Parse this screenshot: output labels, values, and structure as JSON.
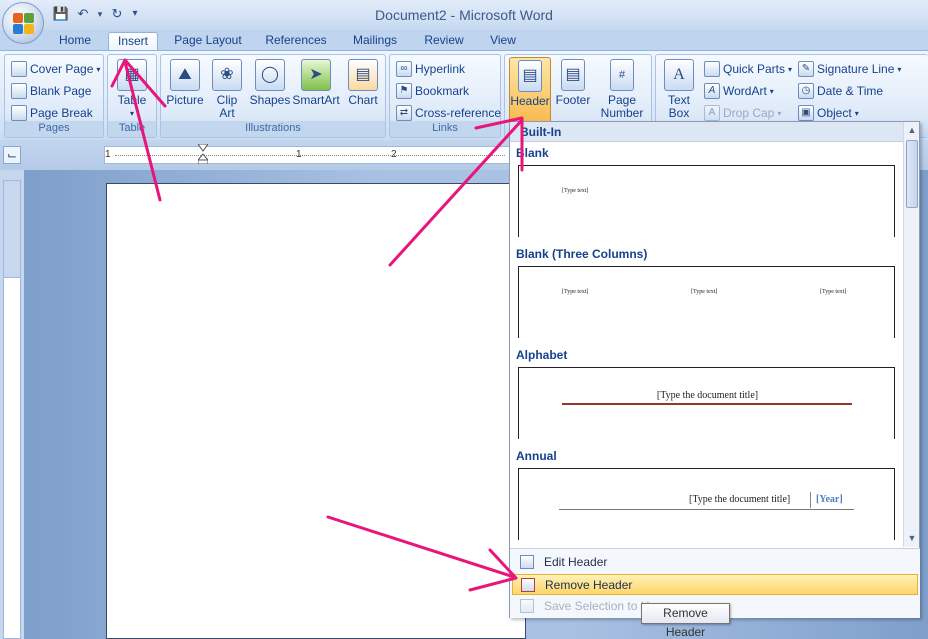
{
  "window": {
    "title": "Document2 - Microsoft Word"
  },
  "qat": {
    "save_icon": "save-icon",
    "undo_icon": "undo-icon",
    "redo_icon": "redo-icon",
    "customize_icon": "customize-qat-icon"
  },
  "tabs": [
    {
      "label": "Home"
    },
    {
      "label": "Insert",
      "active": true
    },
    {
      "label": "Page Layout"
    },
    {
      "label": "References"
    },
    {
      "label": "Mailings"
    },
    {
      "label": "Review"
    },
    {
      "label": "View"
    }
  ],
  "ribbon": {
    "pages": {
      "label": "Pages",
      "cover_page": "Cover Page",
      "blank_page": "Blank Page",
      "page_break": "Page Break"
    },
    "tables": {
      "label": "Table",
      "table": "Table"
    },
    "illustrations": {
      "label": "Illustrations",
      "picture": "Picture",
      "clip_art_1": "Clip",
      "clip_art_2": "Art",
      "shapes": "Shapes",
      "smartart": "SmartArt",
      "chart": "Chart"
    },
    "links": {
      "label": "Links",
      "hyperlink": "Hyperlink",
      "bookmark": "Bookmark",
      "cross_reference": "Cross-reference"
    },
    "header_footer": {
      "header": "Header",
      "footer": "Footer",
      "page_number_1": "Page",
      "page_number_2": "Number"
    },
    "text": {
      "text_box_1": "Text",
      "text_box_2": "Box",
      "quick_parts": "Quick Parts",
      "wordart": "WordArt",
      "drop_cap": "Drop Cap",
      "signature_line": "Signature Line",
      "date_time": "Date & Time",
      "object": "Object"
    }
  },
  "ruler": {
    "marks": [
      "1",
      "1",
      "2"
    ]
  },
  "gallery": {
    "header": "Built-In",
    "sections": [
      {
        "title": "Blank",
        "placeholder": "[Type text]"
      },
      {
        "title": "Blank (Three Columns)",
        "placeholders": [
          "[Type text]",
          "[Type text]",
          "[Type text]"
        ]
      },
      {
        "title": "Alphabet",
        "doc_title": "[Type the document title]"
      },
      {
        "title": "Annual",
        "doc_title": "[Type the document title]",
        "year": "[Year]"
      }
    ],
    "menu": {
      "edit_header": "Edit Header",
      "remove_header": "Remove Header",
      "save_selection": "Save Selection to Header Gallery..."
    },
    "save_selection_visible": "Save Selection to H"
  },
  "tooltip": {
    "text": "Remove Header"
  },
  "colors": {
    "annotation_arrow": "#e8157a",
    "ribbon_blue": "#15428b",
    "hover_gold": "#fdd66a"
  }
}
